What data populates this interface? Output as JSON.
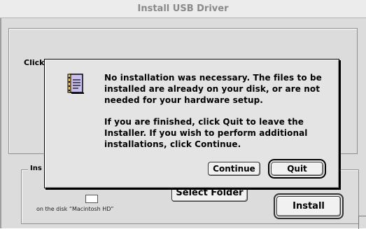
{
  "window": {
    "title": "Install USB Driver",
    "click_text": "Click",
    "group_label": "Ins",
    "disk_text": "on the disk “Macintosh HD”",
    "select_folder_label": "Select Folder",
    "install_label": "Install"
  },
  "dialog": {
    "icon": "note-icon",
    "message_1_line_1": "No installation was necessary. The files to be",
    "message_1_line_2": "installed are already on your disk, or are not",
    "message_1_line_3": "needed for your hardware setup.",
    "message_2_line_1": "If you are finished, click Quit to leave the",
    "message_2_line_2": "Installer. If you wish to perform additional",
    "message_2_line_3": "installations, click Continue.",
    "continue_label": "Continue",
    "quit_label": "Quit"
  }
}
